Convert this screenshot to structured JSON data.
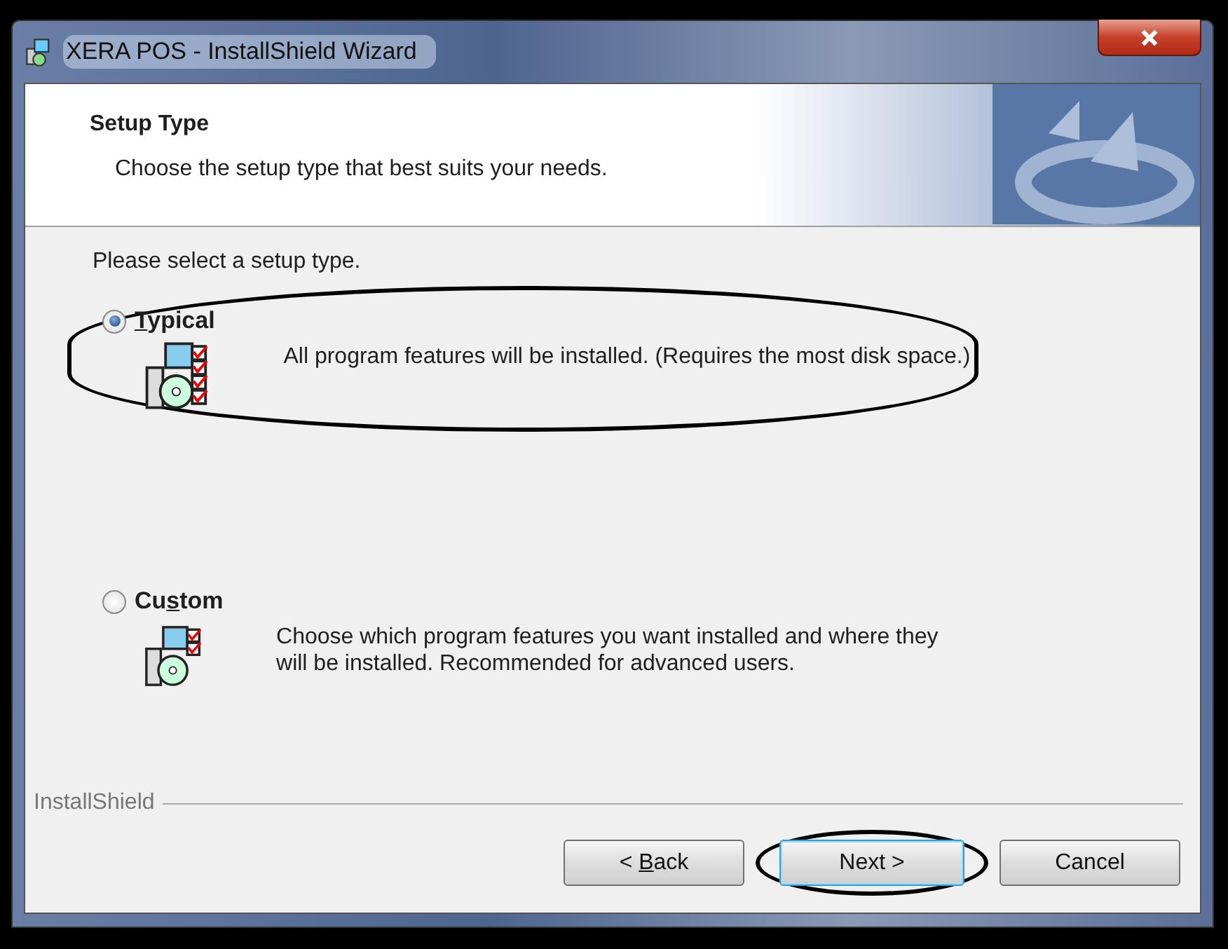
{
  "window": {
    "title": "XERA POS - InstallShield Wizard"
  },
  "header": {
    "title": "Setup Type",
    "subtitle": "Choose the setup type that best suits your needs."
  },
  "prompt": "Please select a setup type.",
  "options": [
    {
      "access_key": "T",
      "label_after": "ypical",
      "description": "All program features will be installed. (Requires the most disk space.)",
      "selected": true,
      "highlighted": true,
      "kind": "full"
    },
    {
      "label_before": "Cu",
      "access_key": "s",
      "label_after": "tom",
      "description": "Choose which program features you want installed and where they will be installed. Recommended for advanced users.",
      "selected": false,
      "highlighted": false,
      "kind": "partial"
    }
  ],
  "footer_label": "InstallShield",
  "buttons": [
    {
      "label_before": "< ",
      "access_key": "B",
      "label_after": "ack",
      "default": false,
      "highlighted": false
    },
    {
      "label_before": "Next >",
      "default": true,
      "highlighted": true
    },
    {
      "label_before": "Cancel",
      "default": false,
      "highlighted": false
    }
  ]
}
